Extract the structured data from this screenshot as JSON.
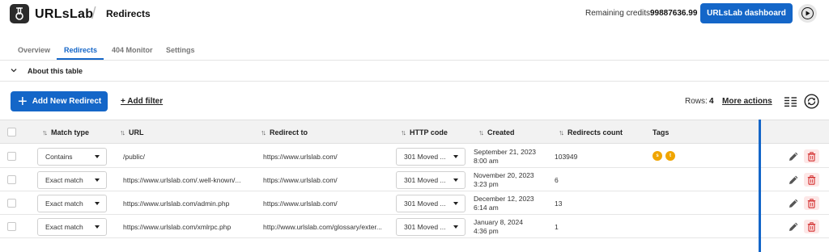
{
  "app": {
    "logo_text": "URLsLab",
    "breadcrumb_separator": "/",
    "breadcrumb": "Redirects",
    "credits_label": "Remaining credits:",
    "credits_value": "99887636.99",
    "dashboard_button": "URLsLab dashboard",
    "logo_icon": "urlslab-logo-icon",
    "play_icon": "play-circle-icon"
  },
  "tabs": [
    {
      "label": "Overview",
      "active": false
    },
    {
      "label": "Redirects",
      "active": true
    },
    {
      "label": "404 Monitor",
      "active": false
    },
    {
      "label": "Settings",
      "active": false
    }
  ],
  "about": {
    "label": "About this table",
    "icon": "chevron-down-icon"
  },
  "toolbar": {
    "add_button": "Add New Redirect",
    "add_filter": "+ Add filter",
    "rows_label": "Rows:",
    "rows_value": "4",
    "more_actions": "More actions",
    "columns_icon": "columns-icon",
    "refresh_icon": "refresh-icon"
  },
  "table": {
    "headers": [
      "Match type",
      "URL",
      "Redirect to",
      "HTTP code",
      "Created",
      "Redirects count",
      "Tags"
    ],
    "rows": [
      {
        "match_type": "Contains",
        "url": "/public/",
        "redirect_to": "https://www.urlslab.com/",
        "http_code": "301 Moved ...",
        "created_date": "September 21, 2023",
        "created_time": "8:00 am",
        "count": "103949",
        "tags": [
          "s",
          "t"
        ]
      },
      {
        "match_type": "Exact match",
        "url": "https://www.urlslab.com/.well-known/...",
        "redirect_to": "https://www.urlslab.com/",
        "http_code": "301 Moved ...",
        "created_date": "November 20, 2023",
        "created_time": "3:23 pm",
        "count": "6",
        "tags": []
      },
      {
        "match_type": "Exact match",
        "url": "https://www.urlslab.com/admin.php",
        "redirect_to": "https://www.urlslab.com/",
        "http_code": "301 Moved ...",
        "created_date": "December 12, 2023",
        "created_time": "6:14 am",
        "count": "13",
        "tags": []
      },
      {
        "match_type": "Exact match",
        "url": "https://www.urlslab.com/xmlrpc.php",
        "redirect_to": "http://www.urlslab.com/glossary/exter...",
        "http_code": "301 Moved ...",
        "created_date": "January 8, 2024",
        "created_time": "4:36 pm",
        "count": "1",
        "tags": []
      }
    ]
  },
  "colors": {
    "accent": "#1466c8",
    "tag": "#f0a500",
    "delete_bg": "#fde7e7",
    "delete_icon": "#d32f2f"
  }
}
